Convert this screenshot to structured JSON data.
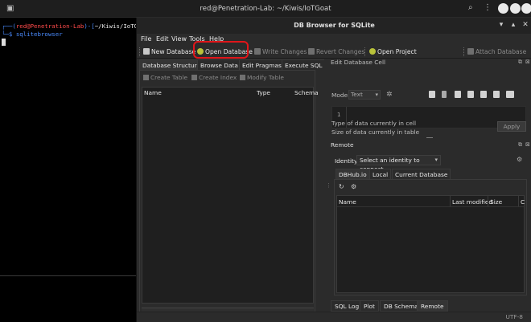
{
  "terminal": {
    "title": "red@Penetration-Lab: ~/Kiwis/IoTGoat",
    "prompt_user": "red@Penetration-Lab",
    "prompt_path": "~/Kiwis/IoTGoat",
    "prompt_prefix": "┌──(",
    "prompt_mid": ")-[",
    "prompt_end": "]",
    "prompt_line2": "└─$ ",
    "command": "sqlitebrowser"
  },
  "window": {
    "title": "DB Browser for SQLite",
    "controls": [
      "▾",
      "▴",
      "✕"
    ]
  },
  "menubar": [
    {
      "label": "File",
      "key": "F"
    },
    {
      "label": "Edit",
      "key": "E"
    },
    {
      "label": "View",
      "key": "V"
    },
    {
      "label": "Tools",
      "key": "T"
    },
    {
      "label": "Help",
      "key": "H"
    }
  ],
  "toolbar": {
    "new_database": "New Database",
    "open_database": "Open Database",
    "write_changes": "Write Changes",
    "revert_changes": "Revert Changes",
    "open_project": "Open Project",
    "attach_database": "Attach Database"
  },
  "main_tabs": [
    "Database Structure",
    "Browse Data",
    "Edit Pragmas",
    "Execute SQL"
  ],
  "structure": {
    "create_table": "Create Table",
    "create_index": "Create Index",
    "modify_table": "Modify Table",
    "columns": [
      "Name",
      "Type",
      "Schema"
    ]
  },
  "edit_cell": {
    "title": "Edit Database Cell",
    "mode_label": "Mode:",
    "mode_value": "Text",
    "line_number": "1",
    "type_info": "Type of data currently in cell",
    "size_info": "Size of data currently in table",
    "apply": "Apply"
  },
  "remote": {
    "title": "Remote",
    "identity_label": "Identity",
    "identity_placeholder": "Select an identity to connect",
    "tabs": [
      "DBHub.io",
      "Local",
      "Current Database"
    ],
    "columns": [
      "Name",
      "Last modified",
      "Size",
      "C"
    ]
  },
  "bottom_tabs": [
    "SQL Log",
    "Plot",
    "DB Schema",
    "Remote"
  ],
  "status": {
    "encoding": "UTF-8"
  }
}
